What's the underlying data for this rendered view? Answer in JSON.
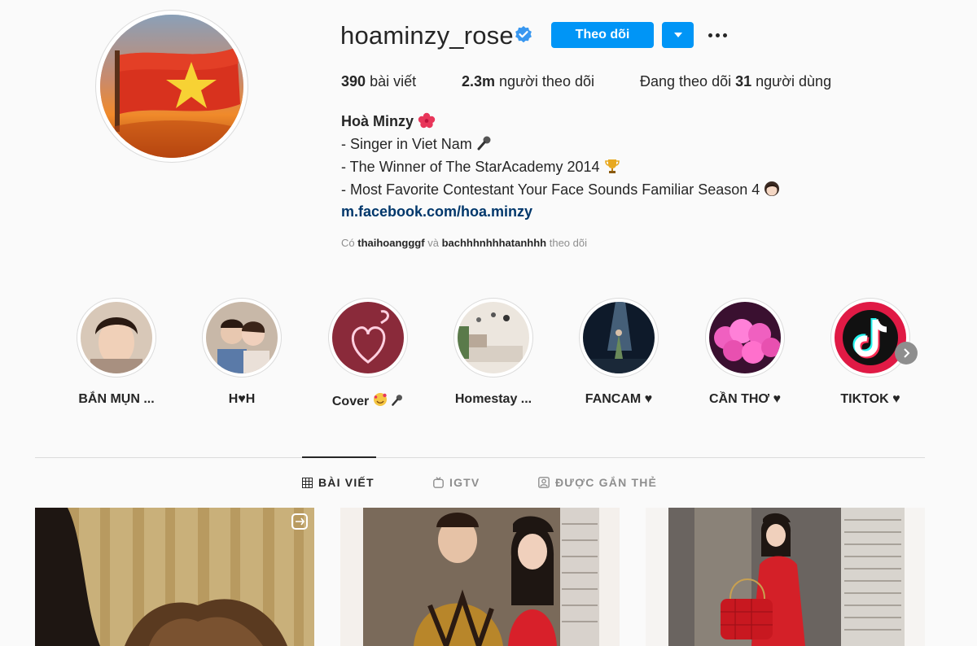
{
  "profile": {
    "username": "hoaminzy_rose",
    "follow_label": "Theo dõi",
    "stats": {
      "posts_count": "390",
      "posts_label": "bài viết",
      "followers_count": "2.3m",
      "followers_label": "người theo dõi",
      "following_prefix": "Đang theo dõi",
      "following_count": "31",
      "following_label": "người dùng"
    },
    "full_name": "Hoà Minzy",
    "bio": [
      "- Singer in Viet Nam",
      "- The Winner of The StarAcademy 2014",
      "- Most Favorite Contestant Your Face Sounds Familiar Season 4"
    ],
    "link": "m.facebook.com/hoa.minzy",
    "followed_by": {
      "prefix": "Có",
      "user1": "thaihoangggf",
      "conj": "và",
      "user2": "bachhhnhhhatanhhh",
      "suffix": "theo dõi"
    }
  },
  "highlights": [
    {
      "label": "BẮN MỤN ...",
      "icon": "selfie"
    },
    {
      "label": "H♥H",
      "icon": "couple"
    },
    {
      "label": "Cover",
      "icon": "neon-heart"
    },
    {
      "label": "Homestay ...",
      "icon": "room"
    },
    {
      "label": "FANCAM ♥",
      "icon": "stage"
    },
    {
      "label": "CẦN THƠ ♥",
      "icon": "balloons"
    },
    {
      "label": "TIKTOK ♥",
      "icon": "tiktok"
    }
  ],
  "tabs": [
    {
      "label": "BÀI VIẾT",
      "active": true
    },
    {
      "label": "IGTV",
      "active": false
    },
    {
      "label": "ĐƯỢC GẮN THẺ",
      "active": false
    }
  ],
  "colors": {
    "accent": "#0095f6",
    "link": "#00376b",
    "muted": "#8e8e8e",
    "background": "#fafafa"
  }
}
